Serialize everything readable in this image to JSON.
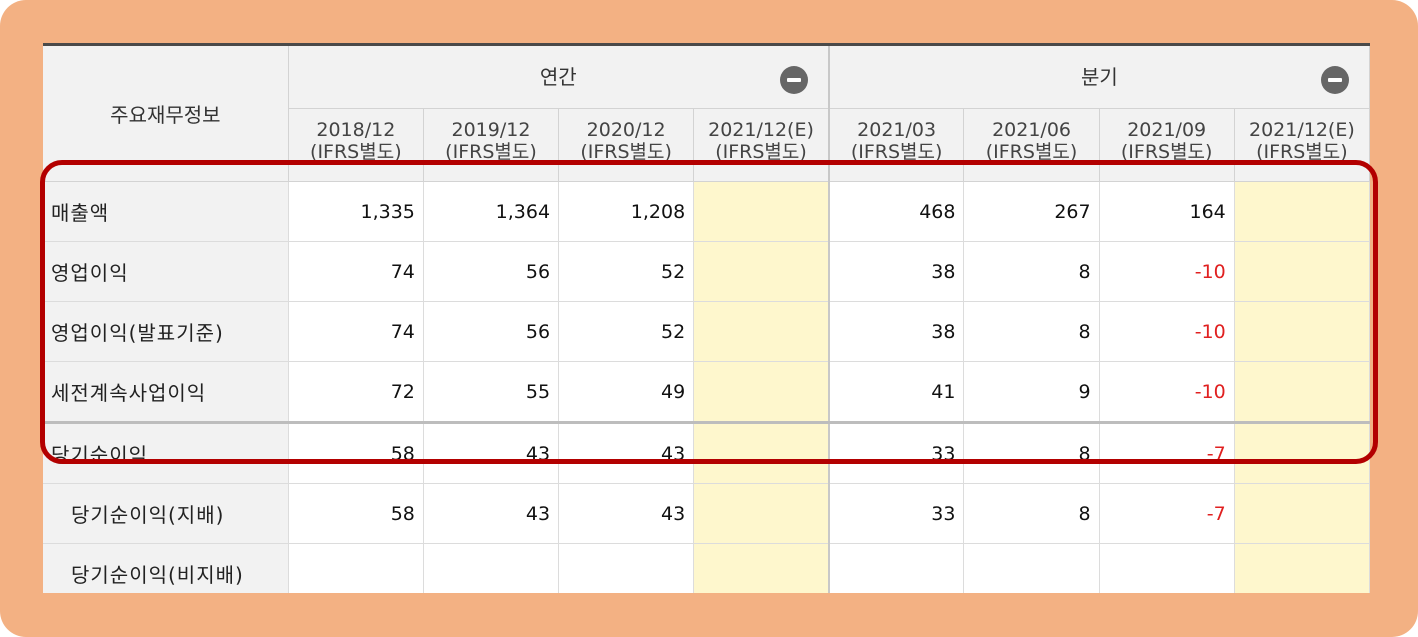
{
  "table": {
    "corner_label": "주요재무정보",
    "groups": [
      {
        "label": "연간",
        "toggle_icon": "minus-circle-icon"
      },
      {
        "label": "분기",
        "toggle_icon": "minus-circle-icon"
      }
    ],
    "periods": [
      {
        "label": "2018/12",
        "sub": "(IFRS별도)"
      },
      {
        "label": "2019/12",
        "sub": "(IFRS별도)"
      },
      {
        "label": "2020/12",
        "sub": "(IFRS별도)"
      },
      {
        "label": "2021/12(E)",
        "sub": "(IFRS별도)"
      },
      {
        "label": "2021/03",
        "sub": "(IFRS별도)"
      },
      {
        "label": "2021/06",
        "sub": "(IFRS별도)"
      },
      {
        "label": "2021/09",
        "sub": "(IFRS별도)"
      },
      {
        "label": "2021/12(E)",
        "sub": "(IFRS별도)"
      }
    ],
    "rows": [
      {
        "label": "매출액",
        "values": [
          "1,335",
          "1,364",
          "1,208",
          "",
          "468",
          "267",
          "164",
          ""
        ]
      },
      {
        "label": "영업이익",
        "values": [
          "74",
          "56",
          "52",
          "",
          "38",
          "8",
          "-10",
          ""
        ]
      },
      {
        "label": "영업이익(발표기준)",
        "values": [
          "74",
          "56",
          "52",
          "",
          "38",
          "8",
          "-10",
          ""
        ]
      },
      {
        "label": "세전계속사업이익",
        "values": [
          "72",
          "55",
          "49",
          "",
          "41",
          "9",
          "-10",
          ""
        ]
      },
      {
        "label": "당기순이익",
        "values": [
          "58",
          "43",
          "43",
          "",
          "33",
          "8",
          "-7",
          ""
        ]
      },
      {
        "label": "당기순이익(지배)",
        "values": [
          "58",
          "43",
          "43",
          "",
          "33",
          "8",
          "-7",
          ""
        ]
      },
      {
        "label": "당기순이익(비지배)",
        "values": [
          "",
          "",
          "",
          "",
          "",
          "",
          "",
          ""
        ]
      }
    ]
  },
  "colors": {
    "frame": "#f3b183",
    "header_bg": "#f2f2f2",
    "estimate_bg": "#fef7cd",
    "negative_text": "#e02020",
    "highlight_border": "#b30000"
  }
}
